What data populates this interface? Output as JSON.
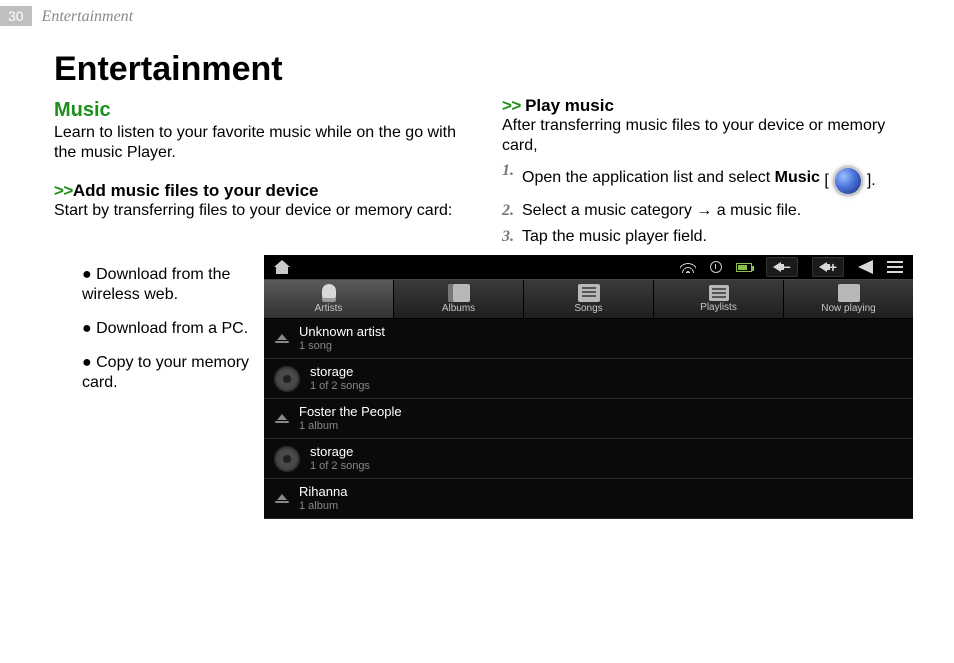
{
  "header": {
    "page_number": "30",
    "section": "Entertainment"
  },
  "left": {
    "title": "Entertainment",
    "music_heading": "Music",
    "music_para": "Learn to listen to your favorite music while on the go with the music Player.",
    "add_chevrons": ">>",
    "add_heading": "Add music files to your device",
    "add_para": "Start by transferring files to your device or memory card:",
    "bullets": [
      "Download from the wireless web.",
      "Download from a PC.",
      "Copy to your memory card."
    ]
  },
  "right": {
    "play_chevrons": ">> ",
    "play_heading": "Play music",
    "play_para": "After transferring music files to your device or memory card,",
    "step1_a": "Open the application list and select ",
    "step1_b": "Music",
    "step1_br_open": "[",
    "step1_br_close": "].",
    "step2": "Select a music category → a music file.",
    "step3": "Tap the music player field."
  },
  "device": {
    "status_icons": {
      "home": "home-icon",
      "wifi": "wifi-icon",
      "clock": "clock-icon",
      "battery": "battery-icon",
      "vol_down": "−",
      "vol_up": "+",
      "back": "back-icon",
      "menu": "menu-lines-icon"
    },
    "tabs": [
      {
        "label": "Artists",
        "icon": "mic",
        "active": true
      },
      {
        "label": "Albums",
        "icon": "cam",
        "active": false
      },
      {
        "label": "Songs",
        "icon": "note",
        "active": false
      },
      {
        "label": "Playlists",
        "icon": "list",
        "active": false
      },
      {
        "label": "Now playing",
        "icon": "play",
        "active": false
      }
    ],
    "rows": [
      {
        "title": "Unknown artist",
        "sub": "1 song"
      },
      {
        "title": "storage",
        "sub": "1 of 2 songs"
      },
      {
        "title": "Foster the People",
        "sub": "1 album"
      },
      {
        "title": "storage",
        "sub": "1 of 2 songs"
      },
      {
        "title": "Rihanna",
        "sub": "1 album"
      }
    ]
  }
}
